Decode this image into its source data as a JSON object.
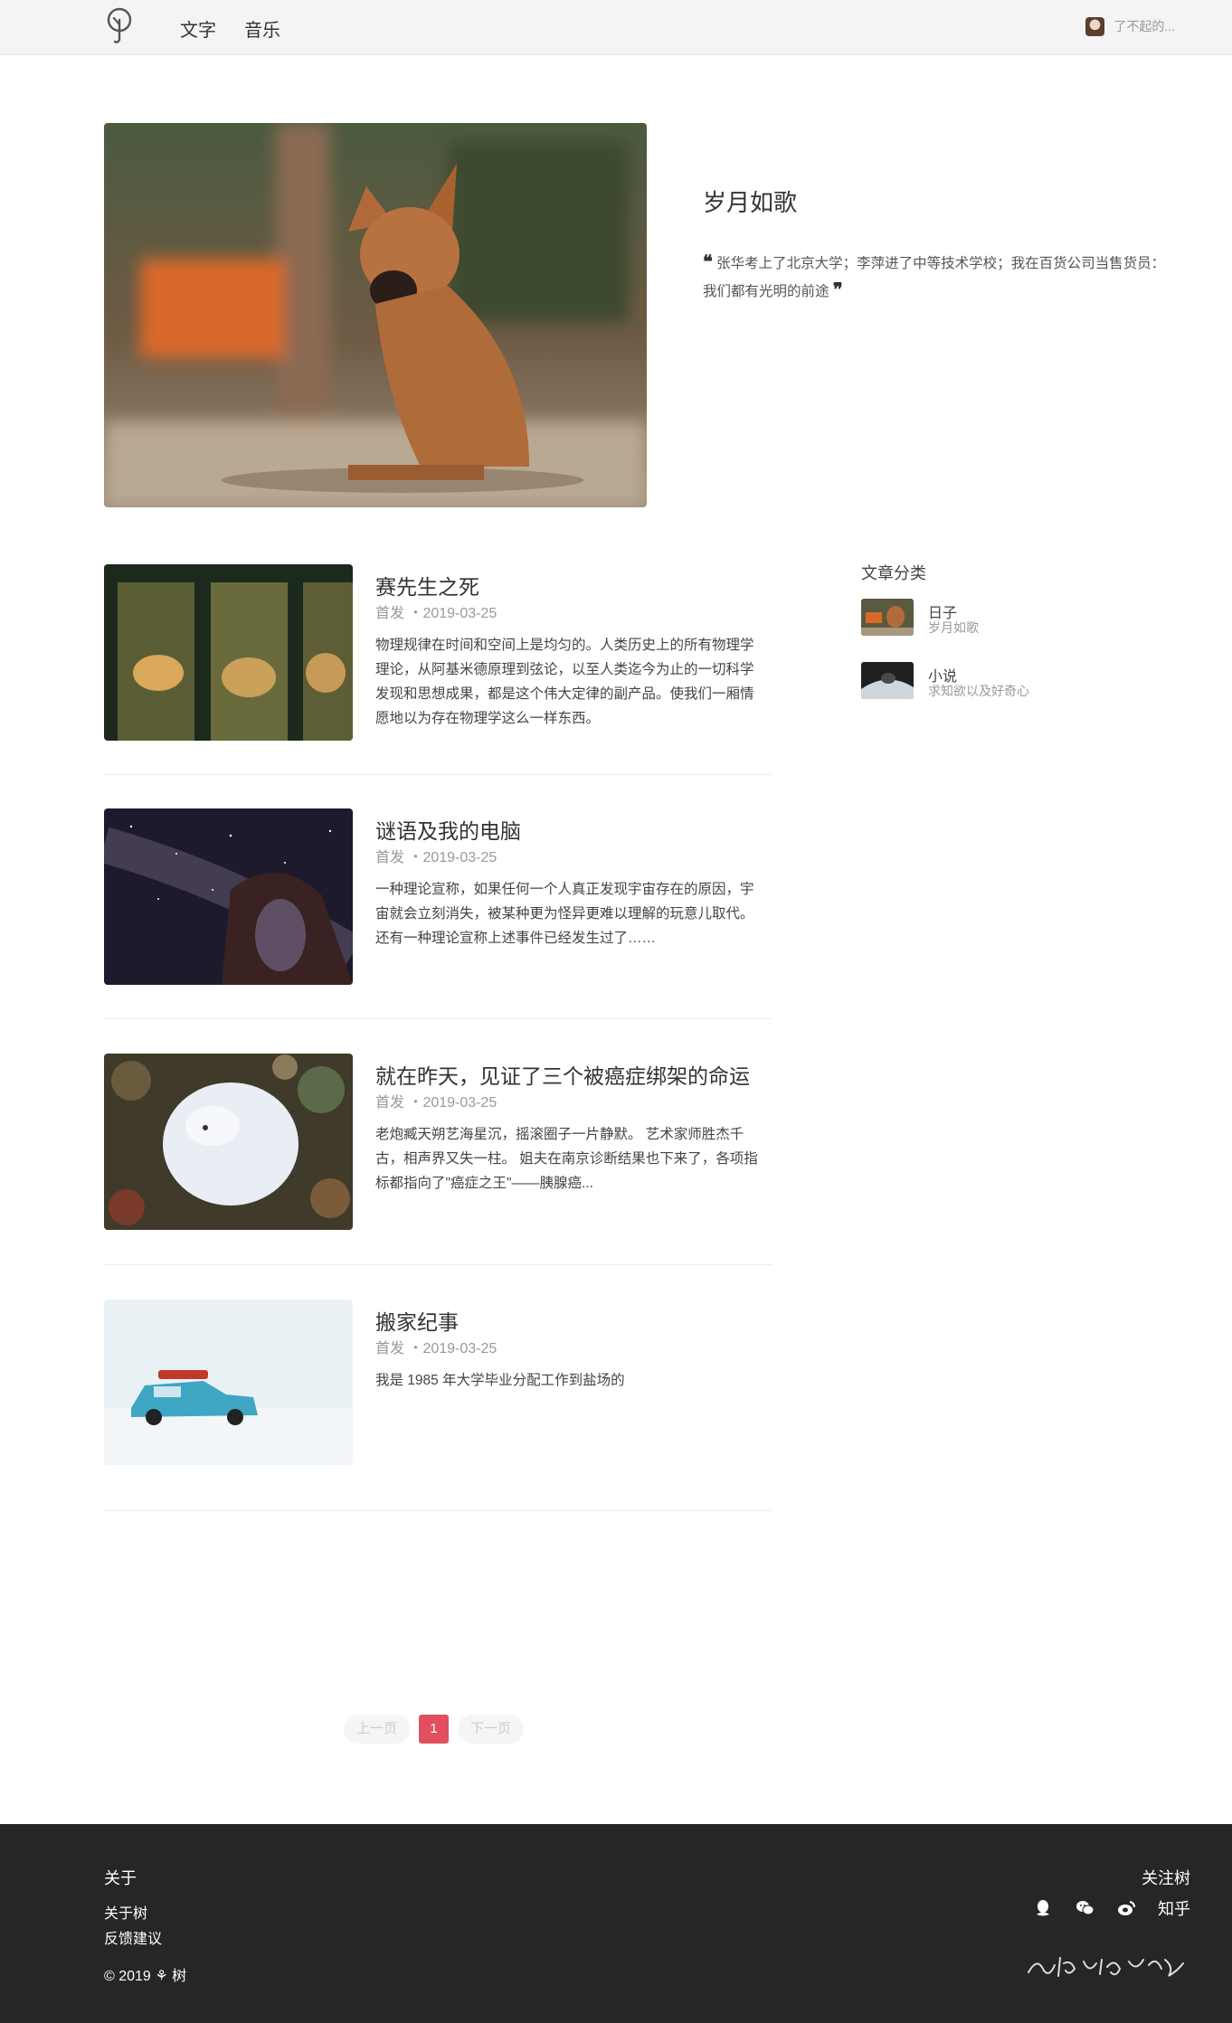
{
  "header": {
    "nav": [
      "文字",
      "音乐"
    ],
    "user_name": "了不起的..."
  },
  "hero": {
    "title": "岁月如歌",
    "quote_open": "❝",
    "quote": "张华考上了北京大学；李萍进了中等技术学校；我在百货公司当售货员：我们都有光明的前途",
    "quote_close": "❞"
  },
  "articles": [
    {
      "title": "赛先生之死",
      "meta": "首发 ・2019-03-25",
      "excerpt": "物理规律在时间和空间上是均匀的。人类历史上的所有物理学理论，从阿基米德原理到弦论，以至人类迄今为止的一切科学发现和思想成果，都是这个伟大定律的副产品。使我们一厢情愿地以为存在物理学这么一样东西。"
    },
    {
      "title": "谜语及我的电脑",
      "meta": "首发 ・2019-03-25",
      "excerpt": " 一种理论宣称，如果任何一个人真正发现宇宙存在的原因，宇宙就会立刻消失，被某种更为怪异更难以理解的玩意儿取代。          还有一种理论宣称上述事件已经发生过了……"
    },
    {
      "title": "就在昨天，见证了三个被癌症绑架的命运",
      "meta": "首发 ・2019-03-25",
      "excerpt": "老炮臧天朔艺海星沉，摇滚圈子一片静默。 艺术家师胜杰千古，相声界又失一柱。 姐夫在南京诊断结果也下来了，各项指标都指向了\"癌症之王\"——胰腺癌..."
    },
    {
      "title": "搬家纪事",
      "meta": "首发 ・2019-03-25",
      "excerpt": "我是 1985 年大学毕业分配工作到盐场的"
    }
  ],
  "sidebar": {
    "title": "文章分类",
    "categories": [
      {
        "name": "日子",
        "desc": "岁月如歌"
      },
      {
        "name": "小说",
        "desc": "求知欲以及好奇心"
      }
    ]
  },
  "pagination": {
    "prev": "上一页",
    "current": "1",
    "next": "下一页"
  },
  "footer": {
    "about_title": "关于",
    "links": [
      "关于树",
      "反馈建议"
    ],
    "copyright": "© 2019 ⚘ 树",
    "follow_title": "关注树",
    "zhihu": "知乎"
  },
  "colors": {
    "accent": "#e2505f",
    "footer_bg": "#262626",
    "header_bg": "#f4f4f4"
  }
}
